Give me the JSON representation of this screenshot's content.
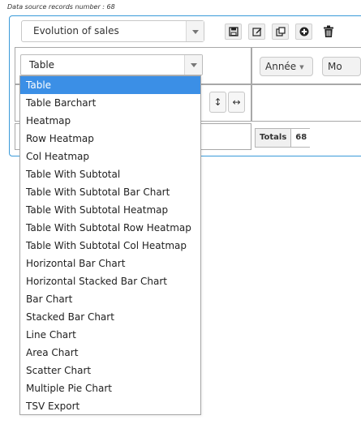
{
  "records_label": "Data source records number : 68",
  "pivot": {
    "name": "Evolution of sales"
  },
  "toolbar": {
    "save_icon": "save-icon",
    "edit_icon": "edit-icon",
    "copy_icon": "copy-icon",
    "add_icon": "plus-circle-icon",
    "delete_icon": "trash-icon"
  },
  "renderer": {
    "selected": "Table",
    "options": [
      "Table",
      "Table Barchart",
      "Heatmap",
      "Row Heatmap",
      "Col Heatmap",
      "Table With Subtotal",
      "Table With Subtotal Bar Chart",
      "Table With Subtotal Heatmap",
      "Table With Subtotal Row Heatmap",
      "Table With Subtotal Col Heatmap",
      "Horizontal Bar Chart",
      "Horizontal Stacked Bar Chart",
      "Bar Chart",
      "Stacked Bar Chart",
      "Line Chart",
      "Area Chart",
      "Scatter Chart",
      "Multiple Pie Chart",
      "TSV Export"
    ]
  },
  "column_fields": [
    {
      "label": "Année"
    },
    {
      "label": "Mo"
    }
  ],
  "sort_buttons": {
    "row_order": "↕",
    "col_order": "↔"
  },
  "totals": {
    "label": "Totals",
    "value": "68"
  },
  "colors": {
    "accent": "#3a9ad9",
    "selected": "#3b8fe6"
  }
}
